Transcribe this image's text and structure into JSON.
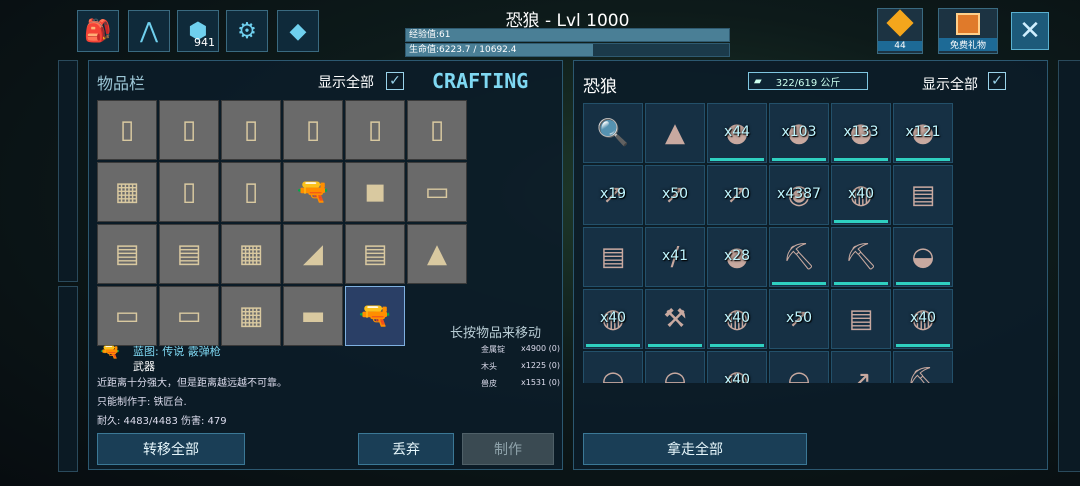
{
  "top_icons": [
    {
      "name": "inventory-backpack-icon",
      "glyph": "🎒",
      "count": ""
    },
    {
      "name": "dino-footprint-icon",
      "glyph": "⋀",
      "count": ""
    },
    {
      "name": "engram-icon",
      "glyph": "⬢",
      "count": "941"
    },
    {
      "name": "settings-icon",
      "glyph": "⚙",
      "count": ""
    },
    {
      "name": "tribe-icon",
      "glyph": "◆",
      "count": ""
    }
  ],
  "header": {
    "title": "恐狼 - Lvl 1000",
    "xp_label": "经验值:61",
    "xp_fraction": 1.0,
    "hp_label": "生命值:6223.7 / 10692.4",
    "hp_fraction": 0.58
  },
  "top_right": {
    "gems_count": "44",
    "gift_label": "免费礼物",
    "close_label": "✕"
  },
  "left_panel": {
    "title": "物品栏",
    "show_all_label": "显示全部",
    "crafting_label": "CRAFTING",
    "move_hint": "长按物品来移动",
    "slots": [
      {
        "glyph": "▯"
      },
      {
        "glyph": "▯"
      },
      {
        "glyph": "▯"
      },
      {
        "glyph": "▯"
      },
      {
        "glyph": "▯"
      },
      {
        "glyph": "▯"
      },
      {
        "glyph": "▦"
      },
      {
        "glyph": "▯"
      },
      {
        "glyph": "▯"
      },
      {
        "glyph": "🔫"
      },
      {
        "glyph": "◼"
      },
      {
        "glyph": "▭"
      },
      {
        "glyph": "▤"
      },
      {
        "glyph": "▤"
      },
      {
        "glyph": "▦"
      },
      {
        "glyph": "◢"
      },
      {
        "glyph": "▤"
      },
      {
        "glyph": "▲"
      },
      {
        "glyph": "▭"
      },
      {
        "glyph": "▭"
      },
      {
        "glyph": "▦"
      },
      {
        "glyph": "▬"
      },
      {
        "glyph": "🔫"
      }
    ],
    "item_info": {
      "name": "蓝图: 传说 霰弹枪",
      "type": "武器",
      "desc": "近距离十分强大，但是距离越远越不可靠。",
      "craft_at": "只能制作于: 铁匠台.",
      "stats": "耐久: 4483/4483 伤害: 479"
    },
    "resources": [
      {
        "name": "金属锭",
        "qty": "x4900 (0)"
      },
      {
        "name": "木头",
        "qty": "x1225 (0)"
      },
      {
        "name": "兽皮",
        "qty": "x1531 (0)"
      }
    ],
    "buttons": {
      "transfer_all": "转移全部",
      "drop": "丢弃",
      "craft": "制作"
    }
  },
  "right_panel": {
    "title": "恐狼",
    "weight": "322/619 公斤",
    "show_all_label": "显示全部",
    "take_all": "拿走全部",
    "slots": [
      {
        "glyph": "🔍",
        "qty": "",
        "dark": true
      },
      {
        "glyph": "▲",
        "qty": "",
        "dark": true
      },
      {
        "glyph": "●",
        "qty": "x44",
        "dark": true,
        "bar": true
      },
      {
        "glyph": "●",
        "qty": "x103",
        "dark": true,
        "bar": true
      },
      {
        "glyph": "●",
        "qty": "x133",
        "dark": true,
        "bar": true
      },
      {
        "glyph": "●",
        "qty": "x121",
        "dark": true,
        "bar": true
      },
      {
        "glyph": "↗",
        "qty": "x19",
        "dark": true
      },
      {
        "glyph": "↗",
        "qty": "x50",
        "dark": true
      },
      {
        "glyph": "↗",
        "qty": "x10",
        "dark": true
      },
      {
        "glyph": "◉",
        "qty": "x4387",
        "dark": true
      },
      {
        "glyph": "◍",
        "qty": "x40",
        "dark": true,
        "bar": true
      },
      {
        "glyph": "▤",
        "qty": "",
        "dark": true
      },
      {
        "glyph": "▤",
        "qty": "",
        "dark": true
      },
      {
        "glyph": "/",
        "qty": "x41",
        "dark": true
      },
      {
        "glyph": "●",
        "qty": "x28",
        "dark": true
      },
      {
        "glyph": "⛏",
        "qty": "",
        "dark": true,
        "bar": true
      },
      {
        "glyph": "⛏",
        "qty": "",
        "dark": true,
        "bar": true
      },
      {
        "glyph": "◒",
        "qty": "",
        "dark": true,
        "bar": true
      },
      {
        "glyph": "◍",
        "qty": "x40",
        "dark": true,
        "bar": true
      },
      {
        "glyph": "⚒",
        "qty": "",
        "dark": true,
        "bar": true
      },
      {
        "glyph": "◍",
        "qty": "x40",
        "dark": true,
        "bar": true
      },
      {
        "glyph": "↗",
        "qty": "x50",
        "dark": true
      },
      {
        "glyph": "▤",
        "qty": "",
        "dark": true
      },
      {
        "glyph": "◍",
        "qty": "x40",
        "dark": true,
        "bar": true
      },
      {
        "glyph": "◒",
        "qty": "",
        "dark": true
      },
      {
        "glyph": "◒",
        "qty": "",
        "dark": true
      },
      {
        "glyph": "◍",
        "qty": "x40",
        "dark": true
      },
      {
        "glyph": "◒",
        "qty": "",
        "dark": true
      },
      {
        "glyph": "↗",
        "qty": "",
        "dark": true
      },
      {
        "glyph": "⛏",
        "qty": "",
        "dark": true
      }
    ]
  }
}
